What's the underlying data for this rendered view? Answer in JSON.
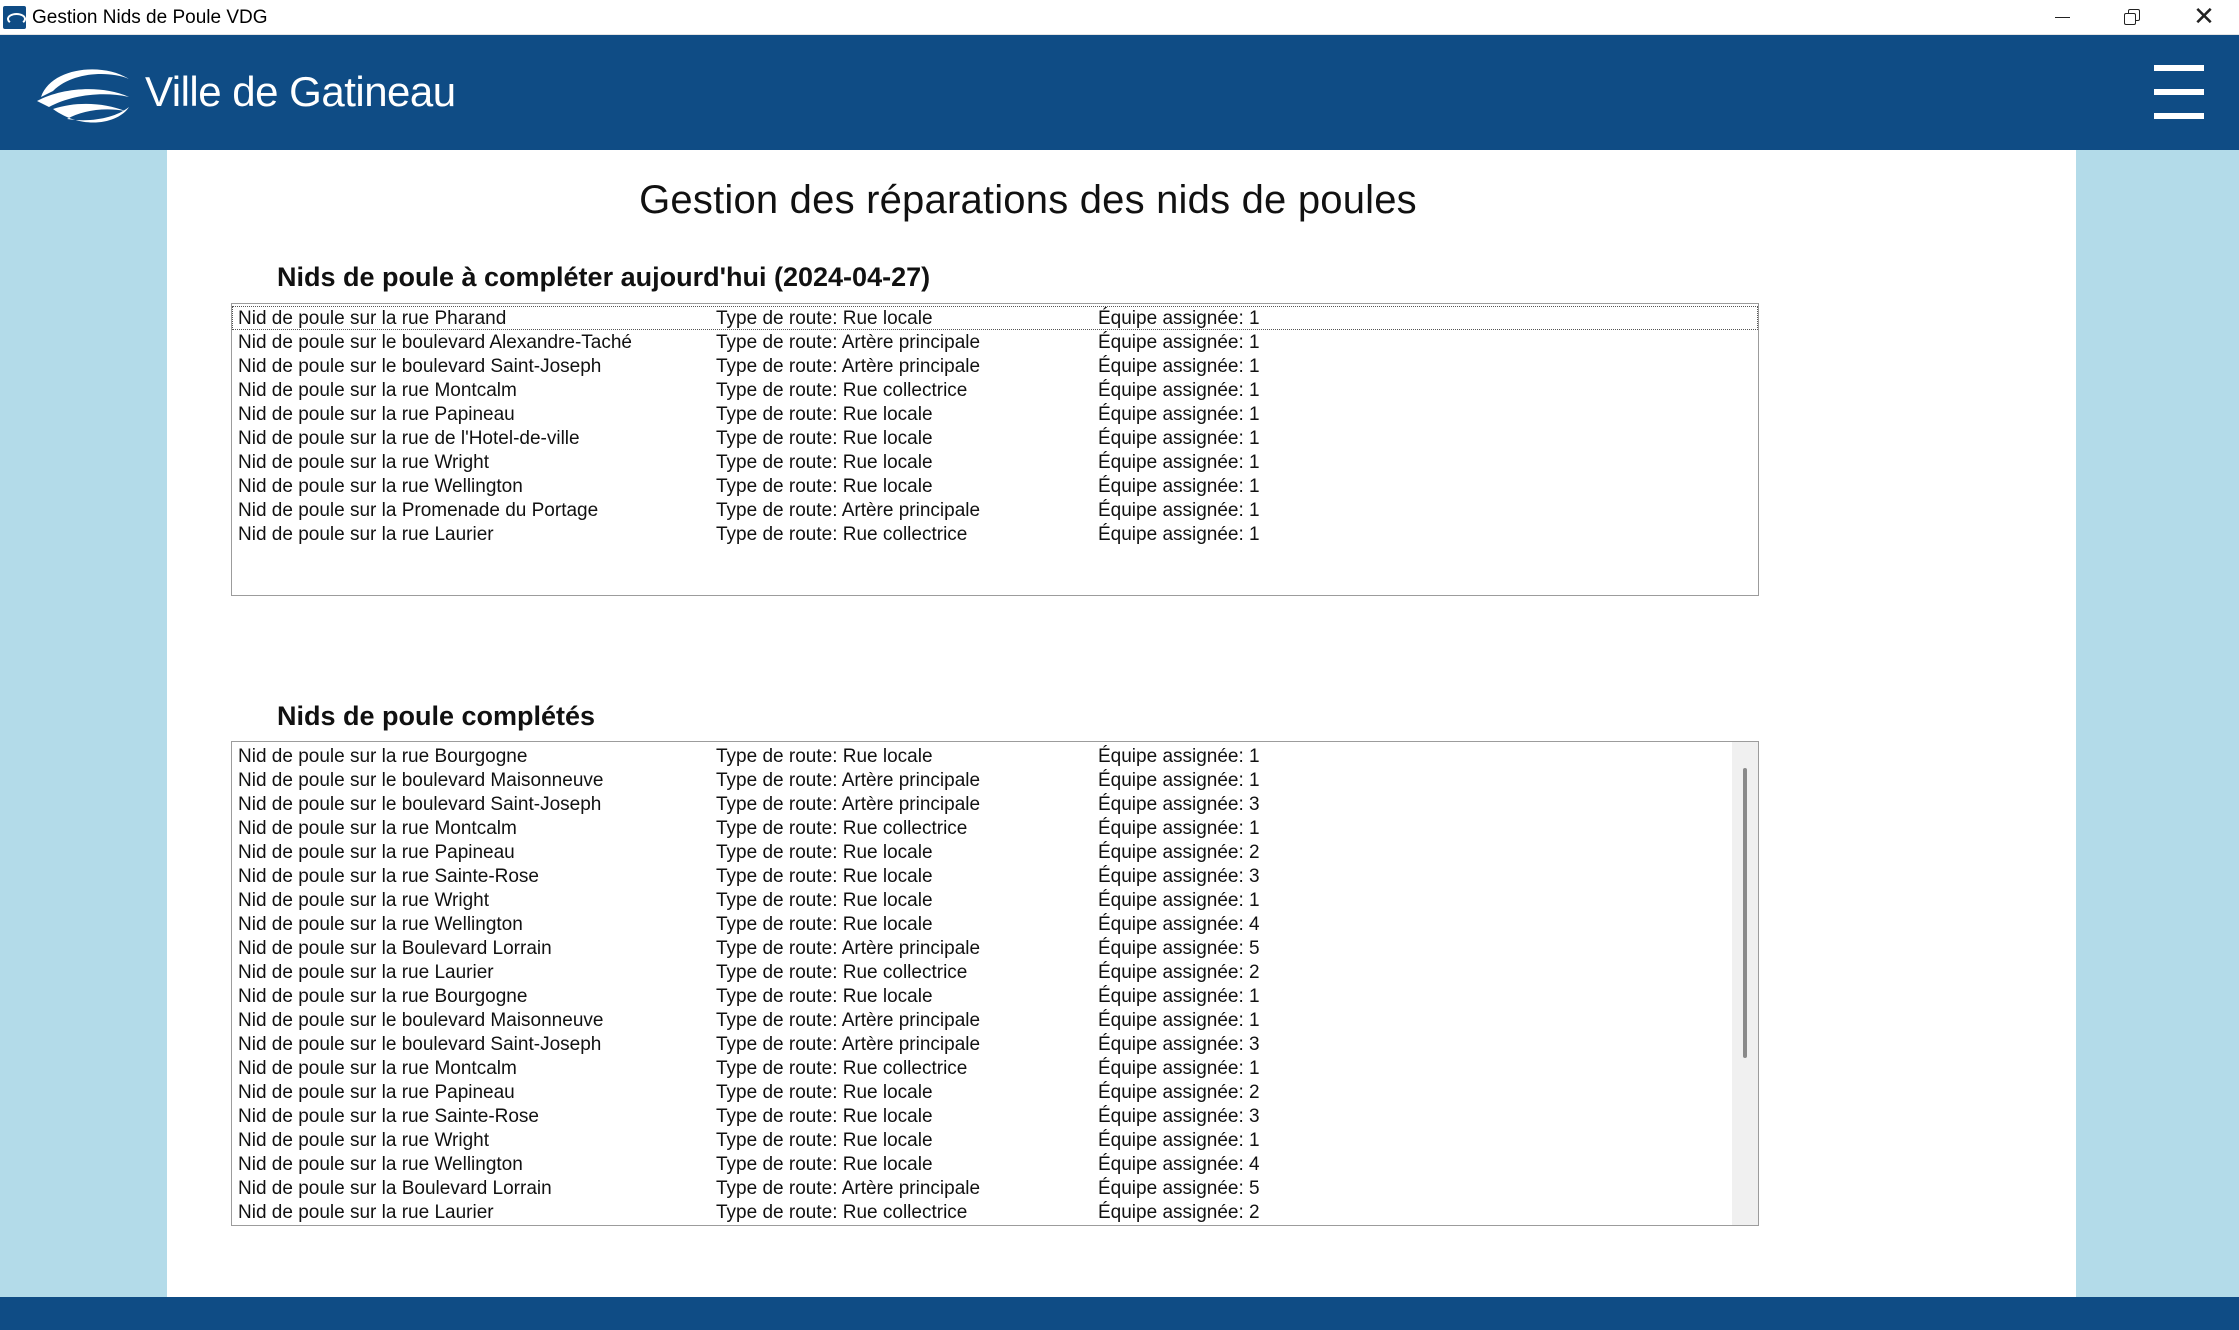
{
  "window": {
    "title": "Gestion Nids de Poule VDG"
  },
  "header": {
    "brand": "Ville de Gatineau",
    "logo_icon": "gatineau-logo-icon",
    "menu_icon": "hamburger-menu-icon",
    "background_color": "#0f4c85"
  },
  "main": {
    "title": "Gestion des réparations des nids de poules",
    "today_section": {
      "title": "Nids de poule à compléter aujourd'hui",
      "date": "(2024-04-27)",
      "items": [
        {
          "name": "Nid de poule sur la rue Pharand",
          "road_type": "Type de route: Rue locale",
          "team": "Équipe assignée: 1"
        },
        {
          "name": "Nid de poule sur le boulevard Alexandre-Taché",
          "road_type": "Type de route: Artère principale",
          "team": "Équipe assignée: 1"
        },
        {
          "name": "Nid de poule sur le boulevard Saint-Joseph",
          "road_type": "Type de route: Artère principale",
          "team": "Équipe assignée: 1"
        },
        {
          "name": "Nid de poule sur la rue Montcalm",
          "road_type": "Type de route: Rue collectrice",
          "team": "Équipe assignée: 1"
        },
        {
          "name": "Nid de poule sur la rue Papineau",
          "road_type": "Type de route: Rue locale",
          "team": "Équipe assignée: 1"
        },
        {
          "name": "Nid de poule sur la rue de l'Hotel-de-ville",
          "road_type": "Type de route: Rue locale",
          "team": "Équipe assignée: 1"
        },
        {
          "name": "Nid de poule sur la rue Wright",
          "road_type": "Type de route: Rue locale",
          "team": "Équipe assignée: 1"
        },
        {
          "name": "Nid de poule sur la rue Wellington",
          "road_type": "Type de route: Rue locale",
          "team": "Équipe assignée: 1"
        },
        {
          "name": "Nid de poule sur la Promenade du Portage",
          "road_type": "Type de route: Artère principale",
          "team": "Équipe assignée: 1"
        },
        {
          "name": "Nid de poule sur la rue Laurier",
          "road_type": "Type de route: Rue collectrice",
          "team": "Équipe assignée: 1"
        }
      ]
    },
    "completed_section": {
      "title": "Nids de poule complétés",
      "items": [
        {
          "name": "Nid de poule sur la rue Bourgogne",
          "road_type": "Type de route: Rue locale",
          "team": "Équipe assignée: 1"
        },
        {
          "name": "Nid de poule sur le boulevard Maisonneuve",
          "road_type": "Type de route: Artère principale",
          "team": "Équipe assignée: 1"
        },
        {
          "name": "Nid de poule sur le boulevard Saint-Joseph",
          "road_type": "Type de route: Artère principale",
          "team": "Équipe assignée: 3"
        },
        {
          "name": "Nid de poule sur la rue Montcalm",
          "road_type": "Type de route: Rue collectrice",
          "team": "Équipe assignée: 1"
        },
        {
          "name": "Nid de poule sur la rue Papineau",
          "road_type": "Type de route: Rue locale",
          "team": "Équipe assignée: 2"
        },
        {
          "name": "Nid de poule sur la rue Sainte-Rose",
          "road_type": "Type de route: Rue locale",
          "team": "Équipe assignée: 3"
        },
        {
          "name": "Nid de poule sur la rue Wright",
          "road_type": "Type de route: Rue locale",
          "team": "Équipe assignée: 1"
        },
        {
          "name": "Nid de poule sur la rue Wellington",
          "road_type": "Type de route: Rue locale",
          "team": "Équipe assignée: 4"
        },
        {
          "name": "Nid de poule sur la Boulevard Lorrain",
          "road_type": "Type de route: Artère principale",
          "team": "Équipe assignée: 5"
        },
        {
          "name": "Nid de poule sur la rue Laurier",
          "road_type": "Type de route: Rue collectrice",
          "team": "Équipe assignée: 2"
        },
        {
          "name": "Nid de poule sur la rue Bourgogne",
          "road_type": "Type de route: Rue locale",
          "team": "Équipe assignée: 1"
        },
        {
          "name": "Nid de poule sur le boulevard Maisonneuve",
          "road_type": "Type de route: Artère principale",
          "team": "Équipe assignée: 1"
        },
        {
          "name": "Nid de poule sur le boulevard Saint-Joseph",
          "road_type": "Type de route: Artère principale",
          "team": "Équipe assignée: 3"
        },
        {
          "name": "Nid de poule sur la rue Montcalm",
          "road_type": "Type de route: Rue collectrice",
          "team": "Équipe assignée: 1"
        },
        {
          "name": "Nid de poule sur la rue Papineau",
          "road_type": "Type de route: Rue locale",
          "team": "Équipe assignée: 2"
        },
        {
          "name": "Nid de poule sur la rue Sainte-Rose",
          "road_type": "Type de route: Rue locale",
          "team": "Équipe assignée: 3"
        },
        {
          "name": "Nid de poule sur la rue Wright",
          "road_type": "Type de route: Rue locale",
          "team": "Équipe assignée: 1"
        },
        {
          "name": "Nid de poule sur la rue Wellington",
          "road_type": "Type de route: Rue locale",
          "team": "Équipe assignée: 4"
        },
        {
          "name": "Nid de poule sur la Boulevard Lorrain",
          "road_type": "Type de route: Artère principale",
          "team": "Équipe assignée: 5"
        },
        {
          "name": "Nid de poule sur la rue Laurier",
          "road_type": "Type de route: Rue collectrice",
          "team": "Équipe assignée: 2"
        }
      ]
    }
  },
  "colors": {
    "brand_blue": "#0f4c85",
    "page_background": "#b3dbe9",
    "content_background": "#ffffff"
  }
}
